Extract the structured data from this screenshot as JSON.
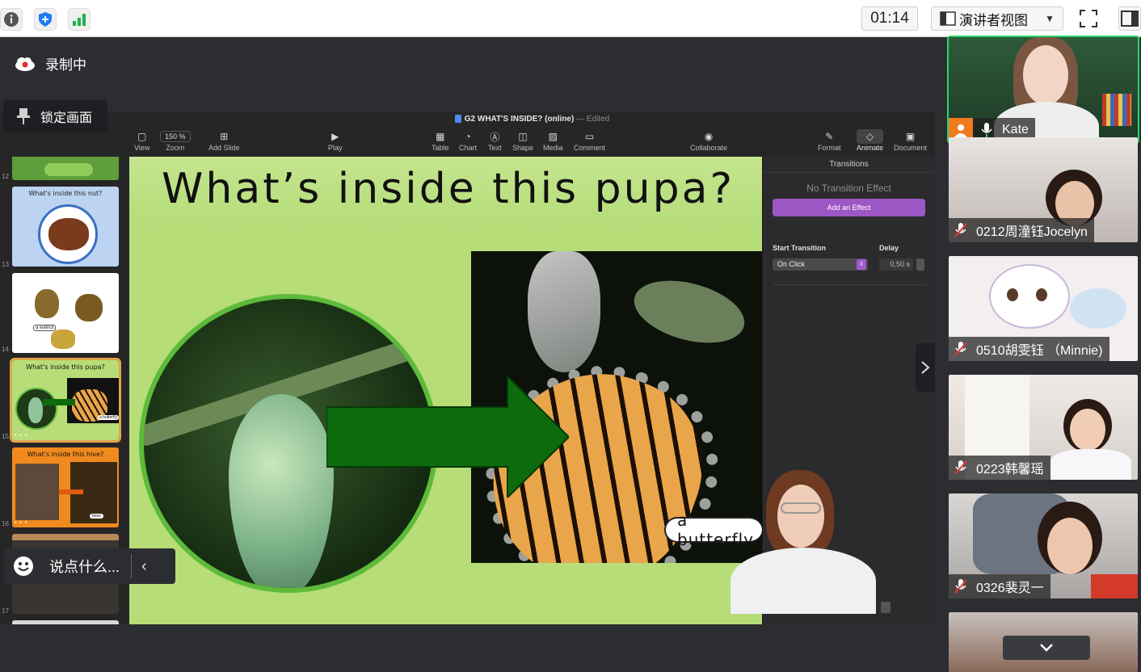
{
  "topbar": {
    "timer": "01:14",
    "presenter_view_label": "演讲者视图"
  },
  "meeting": {
    "recording_label": "录制中",
    "lock_label": "锁定画面",
    "chat_placeholder": "说点什么..."
  },
  "keynote": {
    "document_title": "G2 WHAT'S INSIDE? (online)",
    "document_status": "— Edited",
    "toolbar": {
      "view": "View",
      "zoom_value": "150 %",
      "zoom": "Zoom",
      "add_slide": "Add Slide",
      "play": "Play",
      "table": "Table",
      "chart": "Chart",
      "text": "Text",
      "shape": "Shape",
      "media": "Media",
      "comment": "Comment",
      "collaborate": "Collaborate",
      "format": "Format",
      "animate": "Animate",
      "document": "Document"
    },
    "thumbnails": [
      {
        "num": "12",
        "title": ""
      },
      {
        "num": "13",
        "title": "What's inside this nut?"
      },
      {
        "num": "14",
        "title": "",
        "caption": "a walnut"
      },
      {
        "num": "15",
        "title": "What's inside this pupa?",
        "caption": "a butterfly"
      },
      {
        "num": "16",
        "title": "What's inside this hive?",
        "caption": "bees"
      },
      {
        "num": "17",
        "title": ""
      }
    ],
    "slide": {
      "title": "What’s inside this pupa?",
      "label": "a butterfly"
    },
    "inspector": {
      "header": "Transitions",
      "no_effect": "No Transition Effect",
      "add_effect": "Add an Effect",
      "start_transition_label": "Start Transition",
      "start_transition_value": "On Click",
      "delay_label": "Delay",
      "delay_value": "0,50 s"
    }
  },
  "participants": [
    {
      "name": "Kate",
      "mic": "on"
    },
    {
      "name": "0212周潼钰Jocelyn",
      "mic": "muted"
    },
    {
      "name": "0510胡雯钰 （Minnie)",
      "mic": "muted"
    },
    {
      "name": "0223韩馨瑶",
      "mic": "muted"
    },
    {
      "name": "0326裴灵一",
      "mic": "muted"
    }
  ],
  "colors": {
    "accent_purple": "#9d57c4",
    "active_speaker": "#2bd46b",
    "slide_green": "#b6dd77",
    "arrow_green": "#0d6b0d"
  }
}
